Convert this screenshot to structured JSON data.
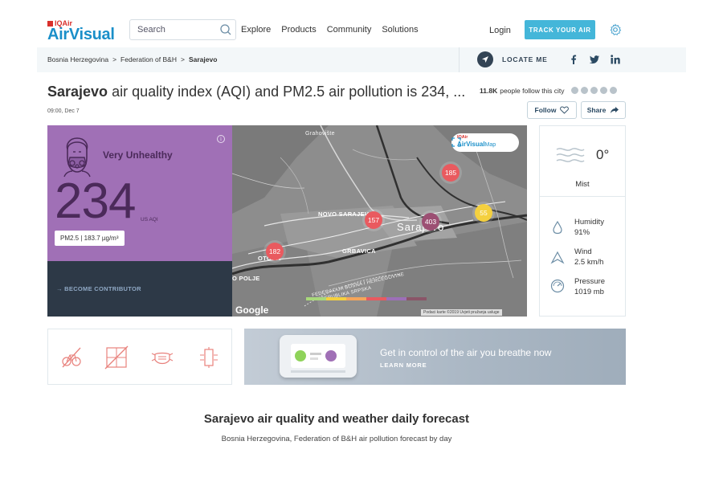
{
  "header": {
    "logo_small": "IQAir",
    "logo_big": "AirVisual",
    "search_placeholder": "Search",
    "nav": [
      "Explore",
      "Products",
      "Community",
      "Solutions"
    ],
    "login": "Login",
    "track_button": "TRACK YOUR AIR"
  },
  "breadcrumb": {
    "items": [
      "Bosnia Herzegovina",
      "Federation of B&H",
      "Sarajevo"
    ],
    "separator": ">",
    "locate_me": "LOCATE ME"
  },
  "city": {
    "name": "Sarajevo",
    "title_rest": " air quality index (AQI) and PM2.5 air pollution is 234, ...",
    "timestamp": "09:00, Dec 7",
    "followers_count": "11.8K",
    "followers_text": "people follow this city",
    "follow_label": "Follow",
    "share_label": "Share"
  },
  "aqi": {
    "status": "Very Unhealthy",
    "value": "234",
    "unit": "US AQI",
    "pm25": "PM2.5 | 183.7 µg/m³",
    "contribute": "→  BECOME CONTRIBUTOR",
    "colors": {
      "card": "#a070b6",
      "text": "#4b2a5a",
      "contribute_bg": "#2d3947"
    }
  },
  "map": {
    "badge_small": "IQAir",
    "badge_big": "AirVisual",
    "badge_suffix": "Map",
    "labels": {
      "grahoviste": "Grahovište",
      "novo_sarajevo": "NOVO SARAJEVO",
      "sarajevo": "Sarajevo",
      "grbavica": "GRBAVICA",
      "otoka": "OTOKA",
      "polje": "O POLJE",
      "federacija": "FEDERACIJA BOSNA I HERCEGOVINE",
      "republika": "REPUBLIKA SRPSKA"
    },
    "markers": [
      {
        "value": "185",
        "color": "#e95a5f"
      },
      {
        "value": "157",
        "color": "#e95a5f"
      },
      {
        "value": "403",
        "color": "#9c4f73"
      },
      {
        "value": "55",
        "color": "#f4d03f"
      },
      {
        "value": "182",
        "color": "#e95a5f"
      }
    ],
    "google": "Google",
    "credit": "Podaci karte ©2019    Uvjeti pružanja usluge"
  },
  "weather": {
    "temp": "0°",
    "condition": "Mist",
    "humidity_label": "Humidity",
    "humidity": "91%",
    "wind_label": "Wind",
    "wind": "2.5 km/h",
    "pressure_label": "Pressure",
    "pressure": "1019 mb"
  },
  "promo": {
    "headline": "Get in control of the air you breathe now",
    "link": "LEARN MORE"
  },
  "forecast": {
    "title": "Sarajevo air quality and weather daily forecast",
    "subtitle": "Bosnia Herzegovina, Federation of B&H air pollution forecast by day"
  }
}
